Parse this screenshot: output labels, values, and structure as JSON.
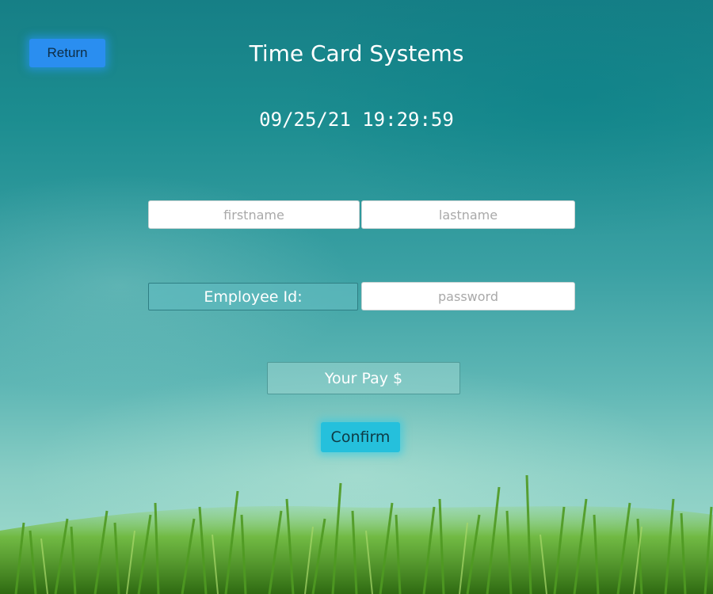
{
  "header": {
    "return_label": "Return",
    "title": "Time Card Systems",
    "datetime": "09/25/21 19:29:59"
  },
  "form": {
    "firstname": {
      "value": "",
      "placeholder": "firstname"
    },
    "lastname": {
      "value": "",
      "placeholder": "lastname"
    },
    "employee_id_label": "Employee Id:",
    "password": {
      "value": "",
      "placeholder": "password"
    },
    "pay_label": "Your Pay $",
    "confirm_label": "Confirm"
  },
  "colors": {
    "return_button": "#2a8ef0",
    "confirm_button": "#25c0dc",
    "sky_top": "#167f86",
    "sky_bottom": "#a6dfcf",
    "grass": "#5aa625"
  },
  "icons": []
}
